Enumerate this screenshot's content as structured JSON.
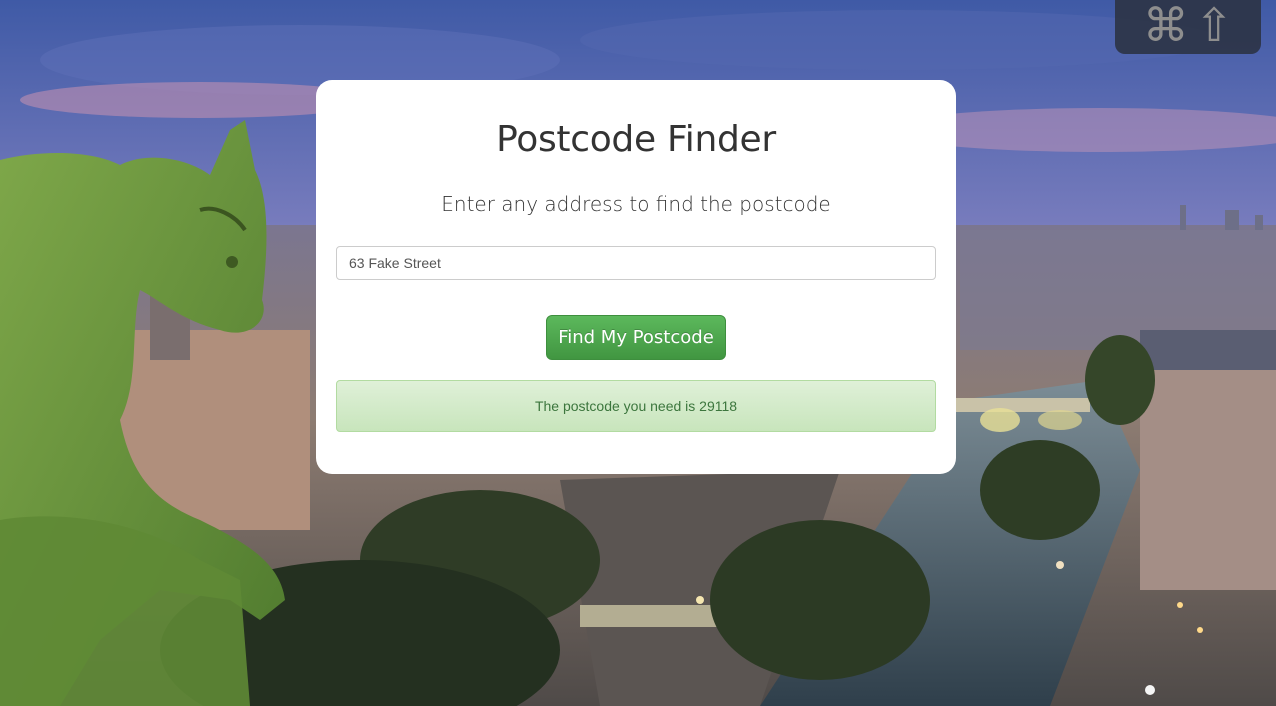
{
  "background": {
    "scene": "Paris skyline at dusk with gargoyle",
    "colors": {
      "sky_top": "#4a5fa8",
      "sky_mid": "#9a86b8",
      "sky_low": "#c79ab6",
      "city": "#8a7a74",
      "river": "#5a6f7e",
      "gargoyle": "#6e9a3c"
    }
  },
  "hotkey_badge": {
    "command_glyph": "⌘",
    "shift_glyph": "⇧"
  },
  "card": {
    "title": "Postcode Finder",
    "subtitle": "Enter any address to find the postcode",
    "address_input": {
      "value": "63 Fake Street",
      "placeholder": ""
    },
    "find_button_label": "Find My Postcode",
    "result_message": "The postcode you need is 29118"
  },
  "colors": {
    "button_green": "#5cb85c",
    "alert_bg": "#dff0d8",
    "alert_text": "#3c763d",
    "title_text": "#333333"
  }
}
